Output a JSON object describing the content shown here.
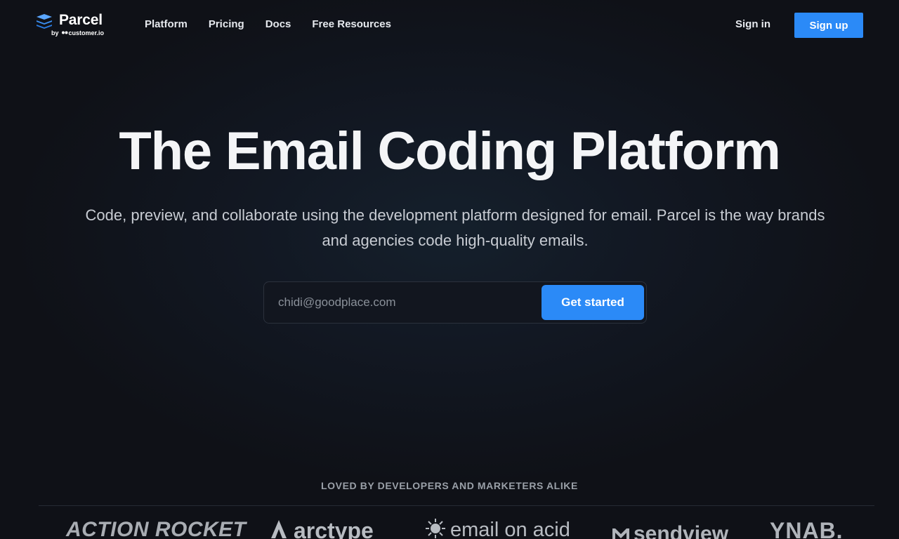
{
  "header": {
    "logo_text": "Parcel",
    "logo_byline_prefix": "by",
    "logo_byline_brand": "customer.io",
    "nav": [
      "Platform",
      "Pricing",
      "Docs",
      "Free Resources"
    ],
    "sign_in": "Sign in",
    "sign_up": "Sign up"
  },
  "hero": {
    "title": "The Email Coding Platform",
    "subtitle": "Code, preview, and collaborate using the development platform designed for email. Parcel is the way brands and agencies code high-quality emails.",
    "email_placeholder": "chidi@goodplace.com",
    "cta": "Get started"
  },
  "logos": {
    "heading": "LOVED BY DEVELOPERS AND MARKETERS ALIKE",
    "brands": [
      "ACTION ROCKET",
      "arctype",
      "email on acid",
      "sendview",
      "YNAB."
    ]
  },
  "colors": {
    "background": "#0f1117",
    "accent": "#2b8af7"
  }
}
